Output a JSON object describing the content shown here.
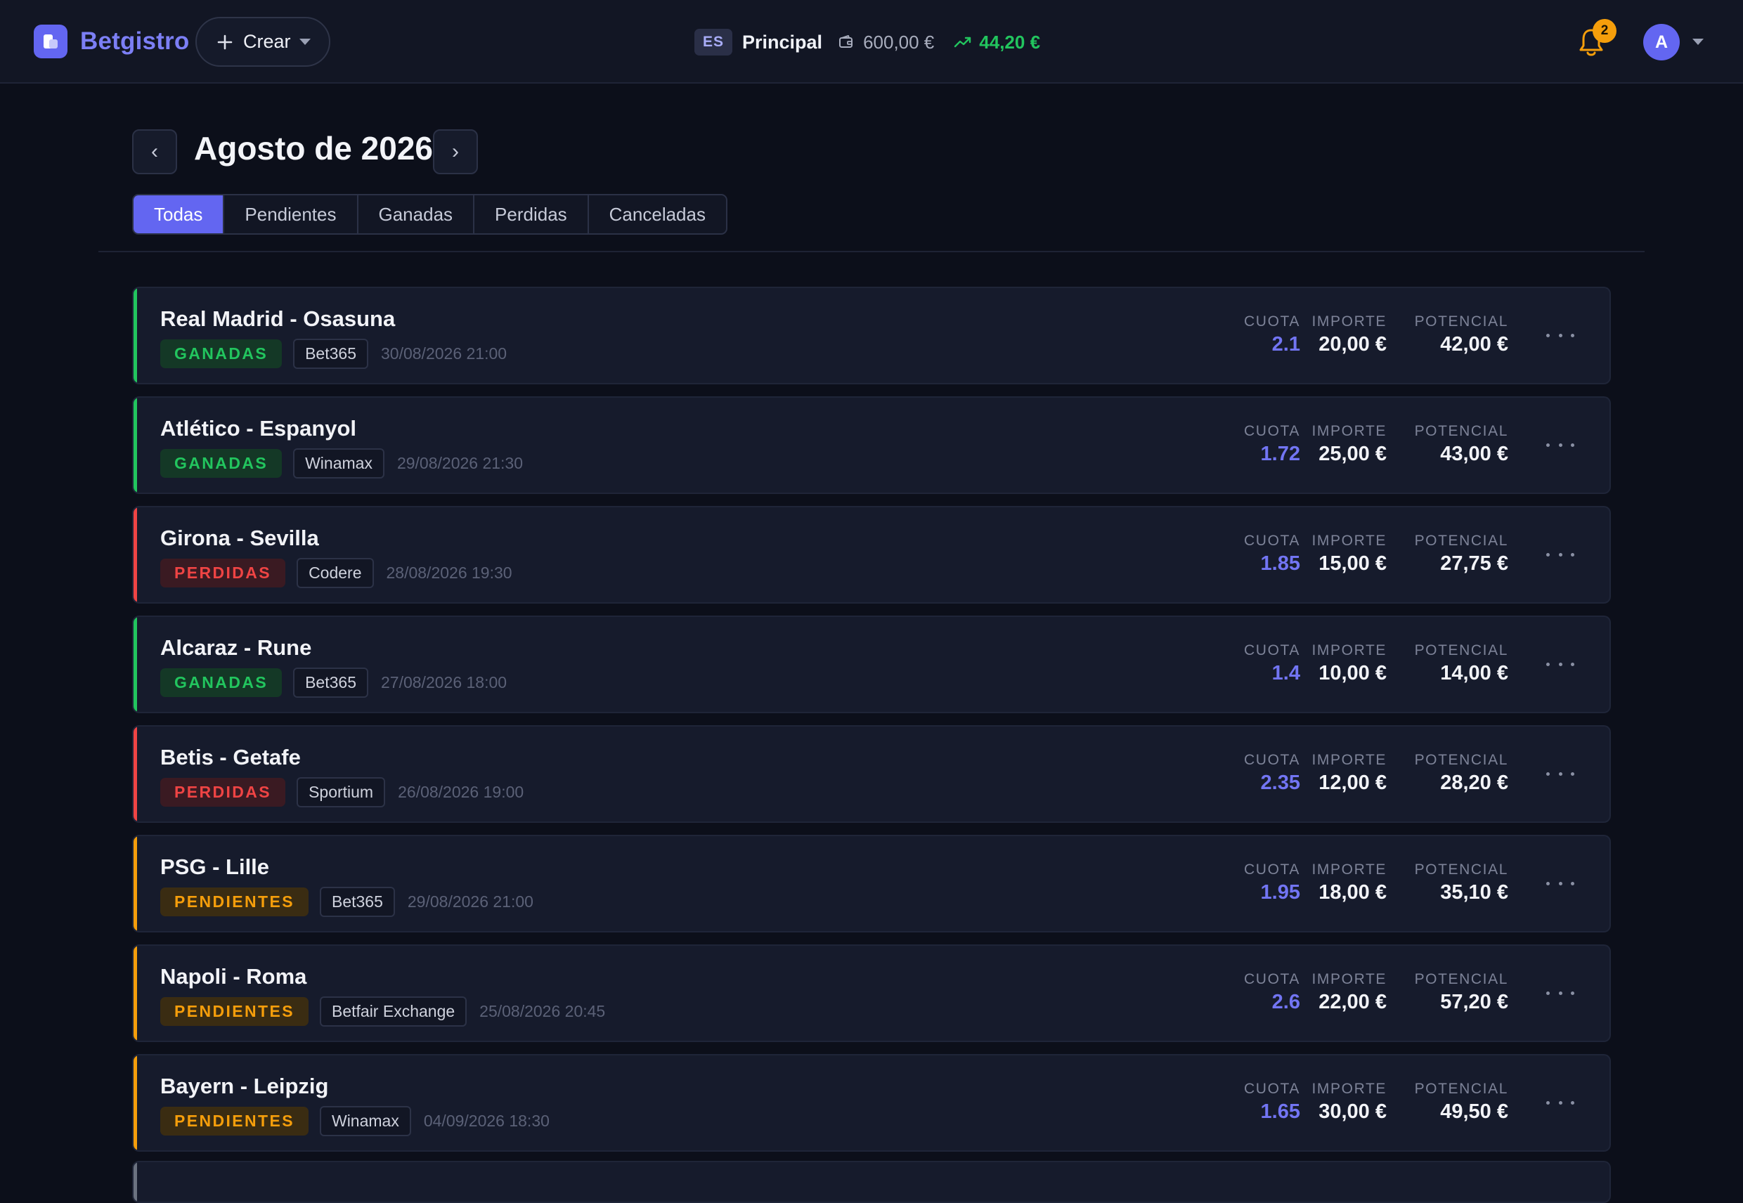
{
  "header": {
    "app_name": "Betgistro",
    "create_label": "Crear",
    "lang": "ES",
    "account": "Principal",
    "balance": "600,00 €",
    "profit": "44,20 €",
    "notifications_count": "2",
    "avatar_initial": "A"
  },
  "colors": {
    "accent": "#6366f1",
    "won": "#22c55e",
    "lost": "#ef4444",
    "pending": "#f59e0b"
  },
  "month": {
    "title": "Agosto de 2026",
    "prev_icon": "‹",
    "next_icon": "›"
  },
  "filters": {
    "tabs": [
      "Todas",
      "Pendientes",
      "Ganadas",
      "Perdidas",
      "Canceladas"
    ],
    "active": "Todas"
  },
  "labels": {
    "cuota": "CUOTA",
    "importe": "IMPORTE",
    "potencial": "POTENCIAL"
  },
  "bets": [
    {
      "title": "Real Madrid - Osasuna",
      "status": "GANADAS",
      "status_type": "won",
      "bookie": "Bet365",
      "date": "30/08/2026 21:00",
      "cuota": "2.1",
      "importe": "20,00 €",
      "potencial": "42,00 €"
    },
    {
      "title": "Atlético - Espanyol",
      "status": "GANADAS",
      "status_type": "won",
      "bookie": "Winamax",
      "date": "29/08/2026 21:30",
      "cuota": "1.72",
      "importe": "25,00 €",
      "potencial": "43,00 €"
    },
    {
      "title": "Girona - Sevilla",
      "status": "PERDIDAS",
      "status_type": "lost",
      "bookie": "Codere",
      "date": "28/08/2026 19:30",
      "cuota": "1.85",
      "importe": "15,00 €",
      "potencial": "27,75 €"
    },
    {
      "title": "Alcaraz - Rune",
      "status": "GANADAS",
      "status_type": "won",
      "bookie": "Bet365",
      "date": "27/08/2026 18:00",
      "cuota": "1.4",
      "importe": "10,00 €",
      "potencial": "14,00 €"
    },
    {
      "title": "Betis - Getafe",
      "status": "PERDIDAS",
      "status_type": "lost",
      "bookie": "Sportium",
      "date": "26/08/2026 19:00",
      "cuota": "2.35",
      "importe": "12,00 €",
      "potencial": "28,20 €"
    },
    {
      "title": "PSG - Lille",
      "status": "PENDIENTES",
      "status_type": "pending",
      "bookie": "Bet365",
      "date": "29/08/2026 21:00",
      "cuota": "1.95",
      "importe": "18,00 €",
      "potencial": "35,10 €"
    },
    {
      "title": "Napoli - Roma",
      "status": "PENDIENTES",
      "status_type": "pending",
      "bookie": "Betfair Exchange",
      "date": "25/08/2026 20:45",
      "cuota": "2.6",
      "importe": "22,00 €",
      "potencial": "57,20 €"
    },
    {
      "title": "Bayern - Leipzig",
      "status": "PENDIENTES",
      "status_type": "pending",
      "bookie": "Winamax",
      "date": "04/09/2026 18:30",
      "cuota": "1.65",
      "importe": "30,00 €",
      "potencial": "49,50 €"
    }
  ]
}
